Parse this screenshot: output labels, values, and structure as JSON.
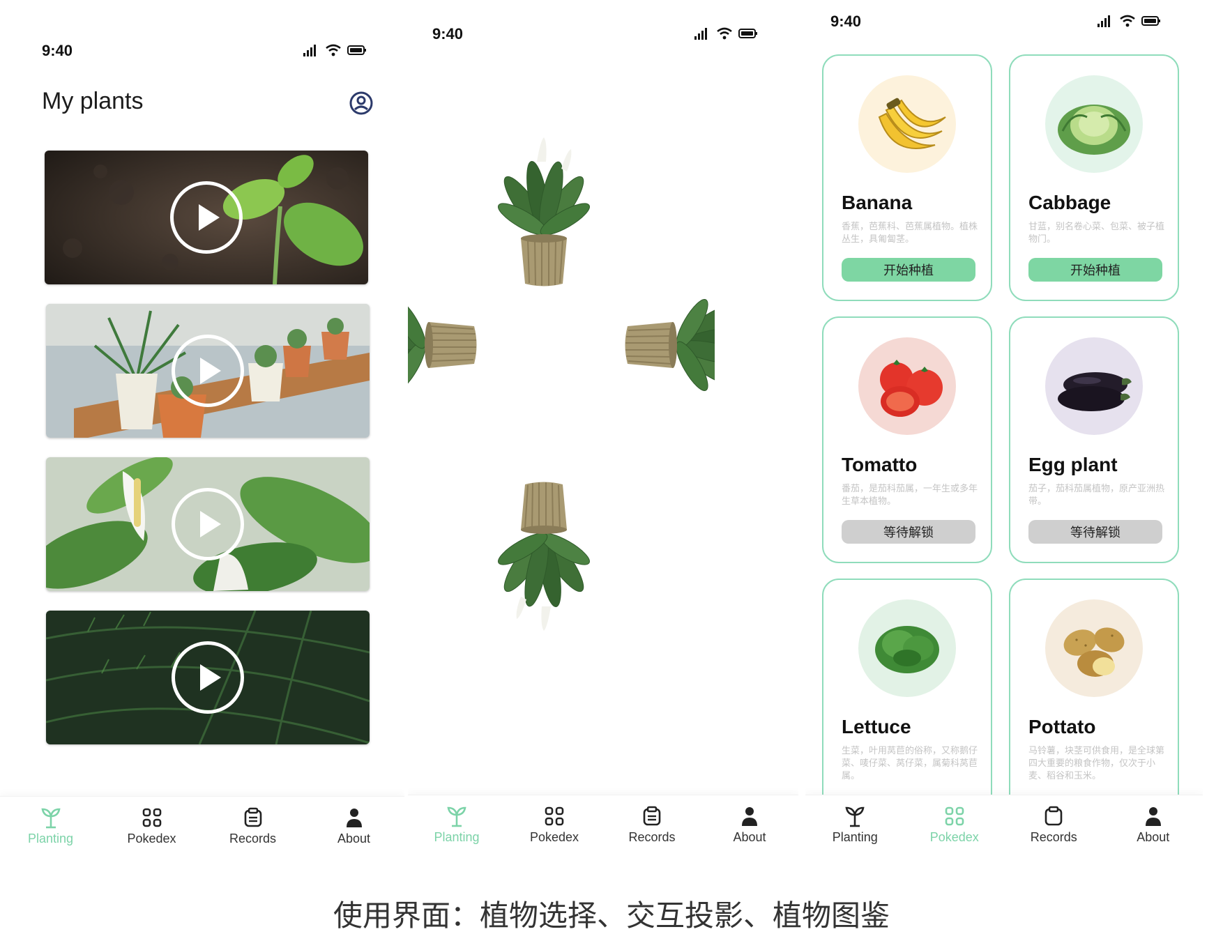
{
  "colors": {
    "accent": "#7cd3a8",
    "card_border": "#8fdcbb",
    "start_button": "#7ed6a3",
    "locked_button": "#cfcfcf"
  },
  "phone1": {
    "status_time": "9:40",
    "title": "My plants",
    "profile_icon": "profile-icon",
    "videos": [
      {
        "name": "seedling-video",
        "play_icon": "play-icon"
      },
      {
        "name": "potted-plants-video",
        "play_icon": "play-icon"
      },
      {
        "name": "peace-lily-video",
        "play_icon": "play-icon"
      },
      {
        "name": "fern-video",
        "play_icon": "play-icon"
      }
    ]
  },
  "phone2": {
    "status_time": "9:40"
  },
  "phone3": {
    "status_time": "9:40",
    "cards": [
      {
        "name": "Banana",
        "desc": "香蕉，芭蕉科、芭蕉属植物。植株丛生，具匍匐茎。",
        "button": "开始种植",
        "state": "start",
        "bg": "#fdf2dc"
      },
      {
        "name": "Cabbage",
        "desc": "甘蓝，别名卷心菜、包菜、被子植物门。",
        "button": "开始种植",
        "state": "start",
        "bg": "#e3f4ea"
      },
      {
        "name": "Tomatto",
        "desc": "番茄，是茄科茄属，一年生或多年生草本植物。",
        "button": "等待解锁",
        "state": "locked",
        "bg": "#f5d9d4"
      },
      {
        "name": "Egg plant",
        "desc": "茄子，茄科茄属植物，原产亚洲热带。",
        "button": "等待解锁",
        "state": "locked",
        "bg": "#e6e1ee"
      },
      {
        "name": "Lettuce",
        "desc": "生菜，叶用莴苣的俗称，又称鹅仔菜、唛仔菜、莴仔菜，属菊科莴苣属。",
        "button": "",
        "state": "",
        "bg": "#e2f2e6"
      },
      {
        "name": "Pottato",
        "desc": "马铃薯，块茎可供食用，是全球第四大重要的粮食作物，仅次于小麦、稻谷和玉米。",
        "button": "",
        "state": "",
        "bg": "#f5ebdd"
      }
    ]
  },
  "tabs": [
    {
      "label": "Planting",
      "icon": "sprout-icon"
    },
    {
      "label": "Pokedex",
      "icon": "grid-icon"
    },
    {
      "label": "Records",
      "icon": "clipboard-icon"
    },
    {
      "label": "About",
      "icon": "person-icon"
    }
  ],
  "active_tabs": {
    "phone1": "Planting",
    "phone2": "Planting",
    "phone3": "Pokedex"
  },
  "caption": "使用界面：植物选择、交互投影、植物图鉴"
}
